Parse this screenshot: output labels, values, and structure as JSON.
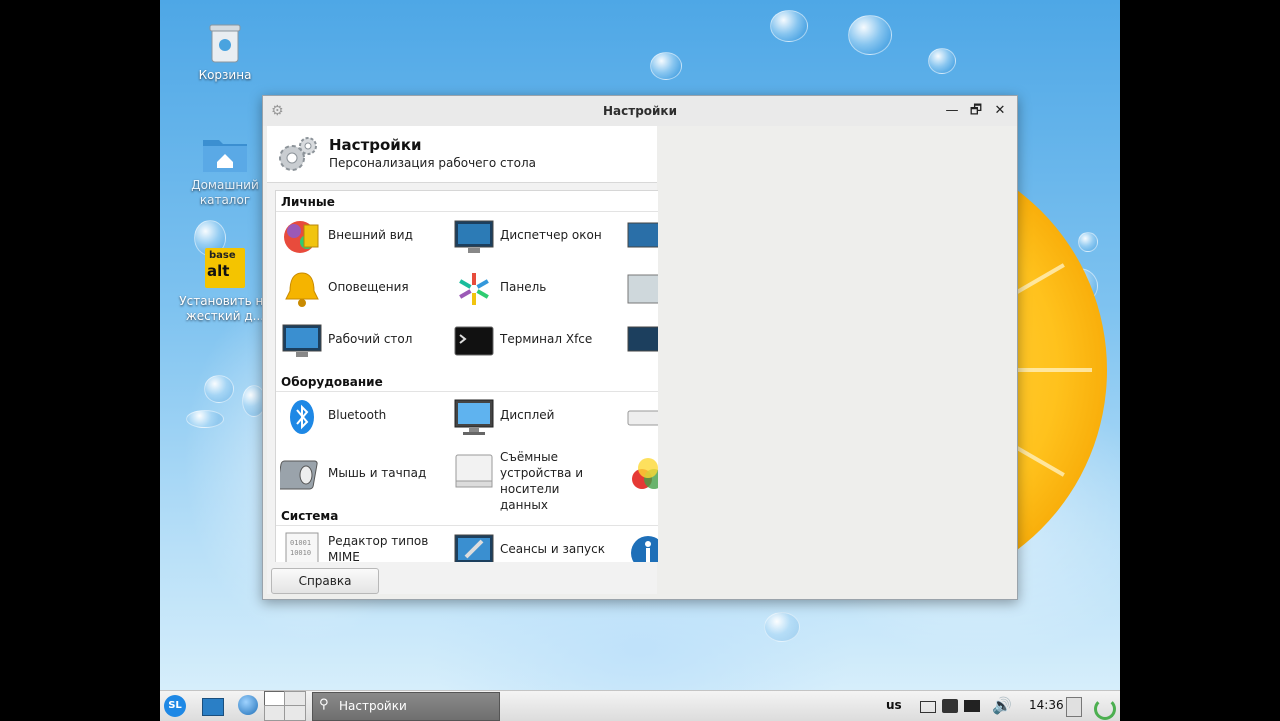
{
  "desktop": {
    "icons": [
      {
        "label": "Корзина"
      },
      {
        "label": "Домашний каталог"
      },
      {
        "label": "Установить на жесткий д..."
      }
    ],
    "logo_text": {
      "base": "base",
      "alt": "alt"
    }
  },
  "window": {
    "title": "Настройки",
    "buttons": {
      "minimize": "—",
      "maximize": "🗗",
      "close": "✕"
    },
    "header": {
      "title": "Настройки",
      "subtitle": "Персонализация рабочего стола"
    },
    "categories": [
      {
        "name": "Личные",
        "items": [
          "Внешний вид",
          "Диспетчер окон",
          "Оповещения",
          "Панель",
          "Рабочий стол",
          "Терминал Xfce"
        ]
      },
      {
        "name": "Оборудование",
        "items": [
          "Bluetooth",
          "Дисплей",
          "Мышь и тачпад",
          "Съёмные устройства и носители данных"
        ]
      },
      {
        "name": "Система",
        "items": [
          "Редактор типов MIME",
          "Сеансы и запуск"
        ]
      }
    ],
    "help_button": "Справка"
  },
  "taskbar": {
    "start_label": "SL",
    "task_label": "Настройки",
    "keyboard_layout": "us",
    "clock": "14:36"
  },
  "colors": {
    "accent": "#1e88e5",
    "lemon": "#ffc21d",
    "sky": "#4ea7e6"
  }
}
